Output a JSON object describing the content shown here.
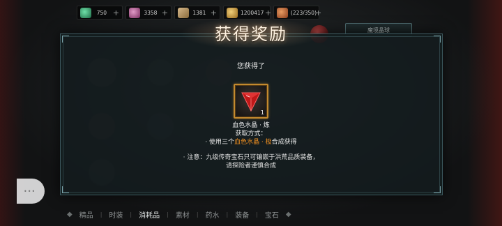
{
  "resources": [
    {
      "icon": "jade-icon",
      "value": "750"
    },
    {
      "icon": "gem-icon",
      "value": "3358"
    },
    {
      "icon": "ticket-icon",
      "value": "1381"
    },
    {
      "icon": "gold-icon",
      "value": "1200417"
    },
    {
      "icon": "bag-icon",
      "value": "(223/350)"
    }
  ],
  "plus_label": "+",
  "top_right_button": "魔境晶球",
  "modal": {
    "title": "获得奖励",
    "got_text": "您获得了",
    "item": {
      "name": "血色水晶 · 炼",
      "count": "1",
      "icon": "red-crystal-icon"
    },
    "obtain_label": "获取方式：",
    "obtain_prefix": "· 使用三个",
    "obtain_highlight": "血色水晶 · 极",
    "obtain_suffix": "合成获得",
    "note_line1": "· 注意：九级传奇宝石只可镶嵌于洪荒品质装备，",
    "note_line2": "请探险者谨慎合成"
  },
  "tabs": [
    {
      "label": "精品",
      "active": false
    },
    {
      "label": "时装",
      "active": false
    },
    {
      "label": "消耗品",
      "active": true
    },
    {
      "label": "素材",
      "active": false
    },
    {
      "label": "药水",
      "active": false
    },
    {
      "label": "装备",
      "active": false
    },
    {
      "label": "宝石",
      "active": false
    }
  ],
  "colors": {
    "highlight": "#f09020",
    "slot_border": "#c48a2e",
    "modal_border": "#3d5a60"
  }
}
